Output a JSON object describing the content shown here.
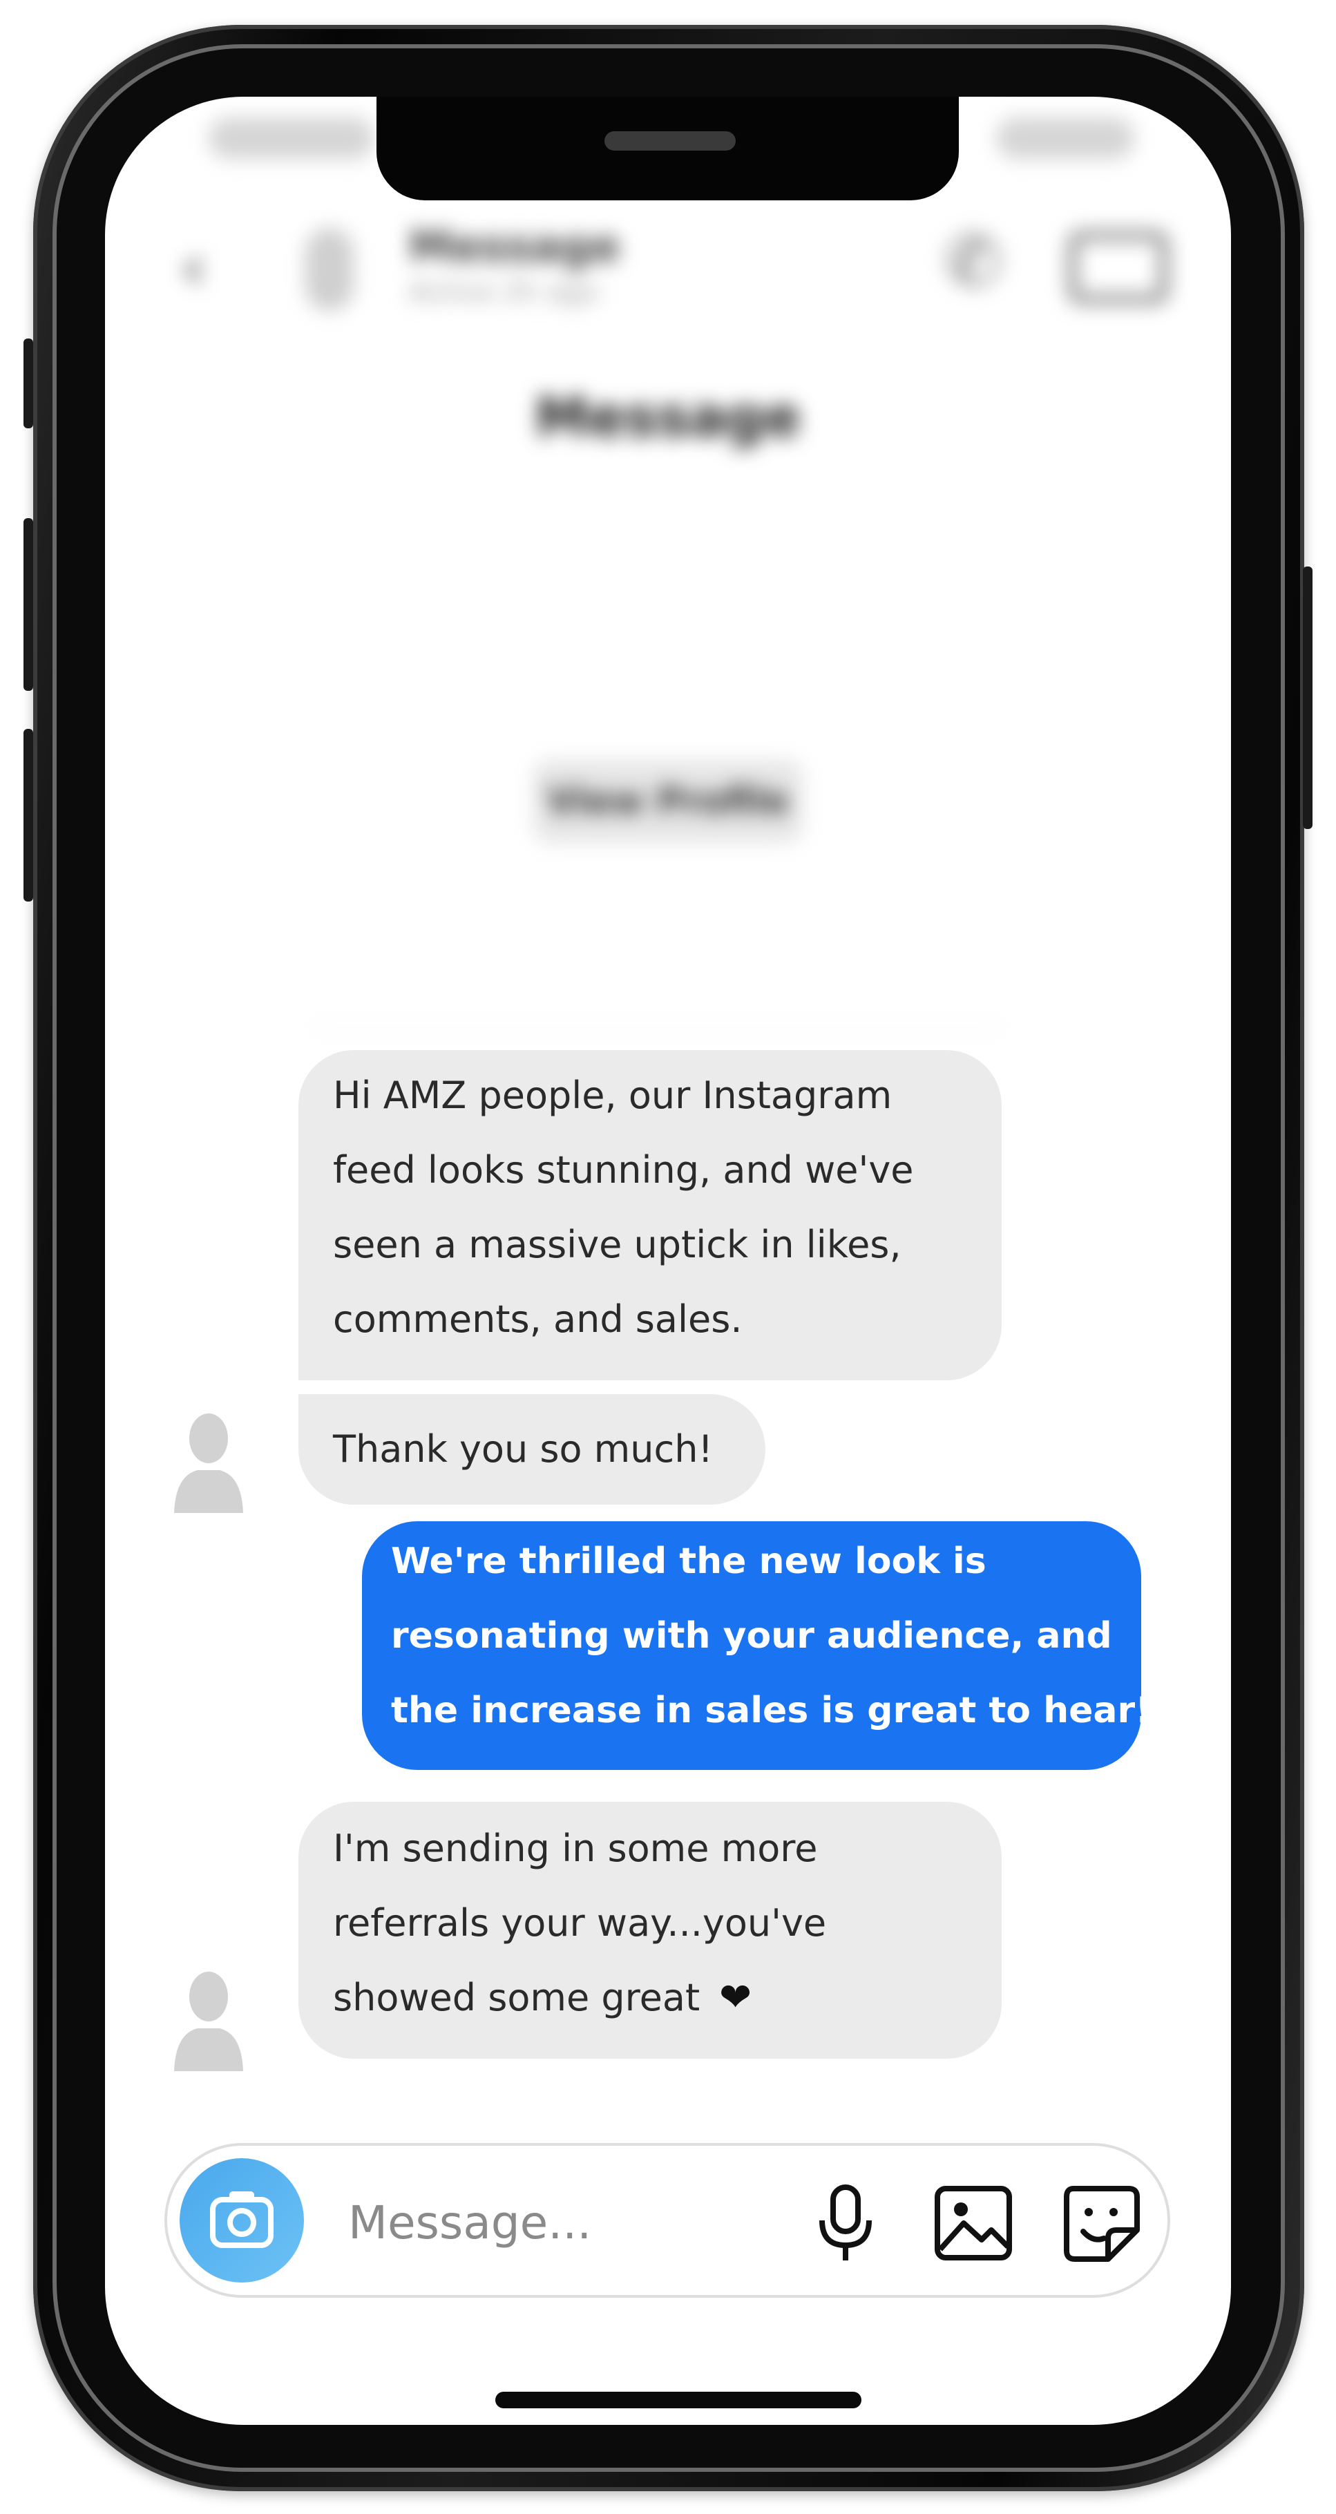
{
  "header": {
    "back_glyph": "‹",
    "contact_name": "Message",
    "contact_sub": "Active 2h ago"
  },
  "profile": {
    "name": "Message",
    "handle_line": "",
    "stats_line": "",
    "follow_line": "",
    "mutual_line": "",
    "view_profile_label": "View Profile"
  },
  "date_separator": "",
  "messages": [
    {
      "direction": "incoming",
      "lines": [
        "Hi AMZ people, our Instagram",
        "feed looks stunning, and we've",
        "seen a massive uptick in likes,",
        "comments, and sales."
      ]
    },
    {
      "direction": "incoming",
      "lines": [
        "Thank you so much!"
      ]
    },
    {
      "direction": "outgoing",
      "lines": [
        "We're thrilled the new look is",
        "resonating with your audience, and",
        "the increase in sales is great to hear!"
      ]
    },
    {
      "direction": "incoming",
      "lines": [
        "I'm sending in some more",
        "referrals your way...you've",
        "showed some great"
      ],
      "trailing_icon": "heart-icon"
    }
  ],
  "composer": {
    "placeholder": "Message...",
    "value": "",
    "icons": [
      "camera-icon",
      "microphone-icon",
      "image-icon",
      "sticker-icon"
    ]
  },
  "colors": {
    "outgoing_bubble": "#1a73f0",
    "incoming_bubble": "#ebebeb",
    "camera_button": "#4aa8ec"
  }
}
